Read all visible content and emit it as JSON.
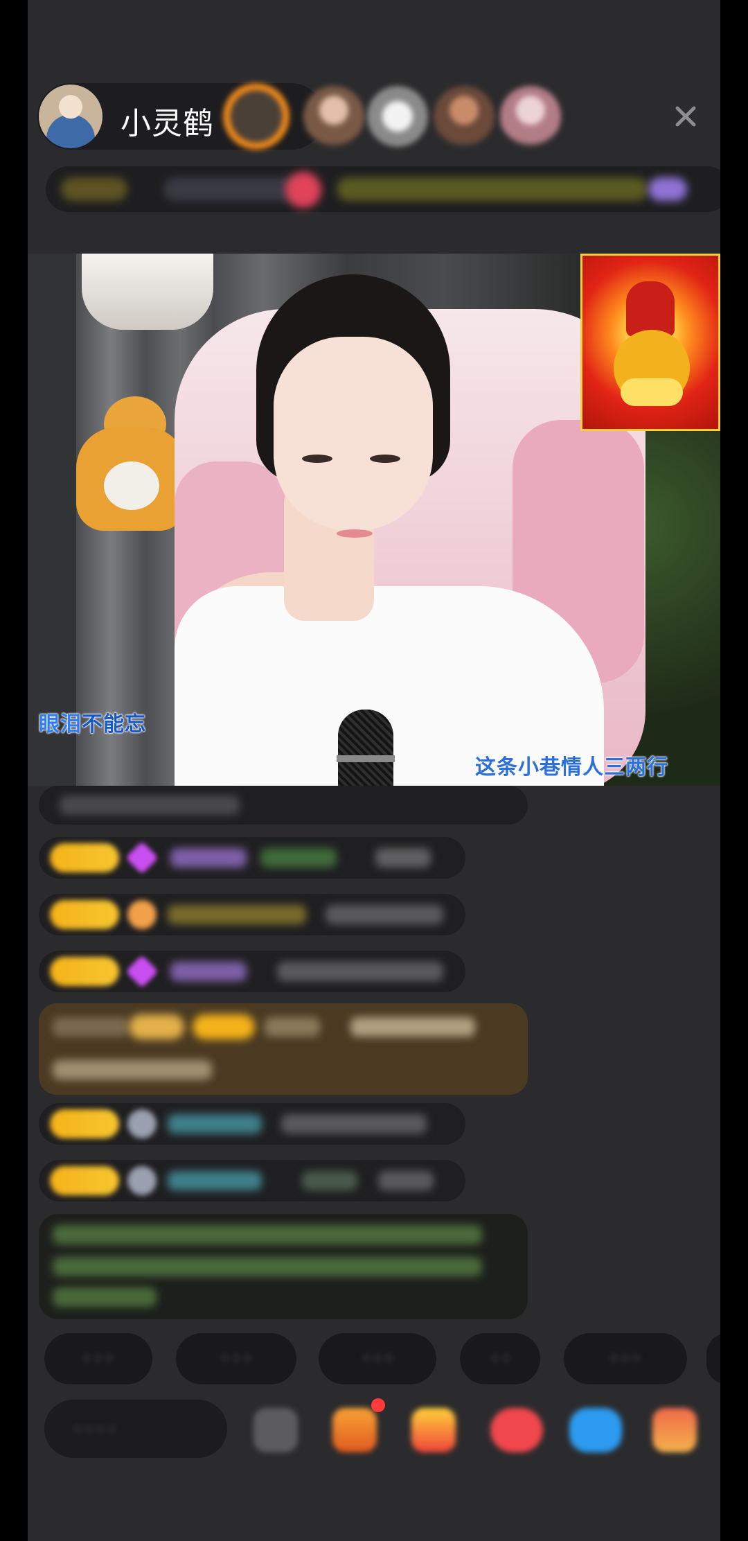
{
  "header": {
    "host_name": "小灵鹤",
    "host_badge_icon": "maple-leaf-icon",
    "viewer_count": 5,
    "close_icon": "close-icon"
  },
  "stats": {
    "items_blurred": true
  },
  "video": {
    "lyric_left_part1": "眼泪",
    "lyric_left_part2": "不能忘",
    "lyric_right": "这条小巷情人三两行",
    "sticker": "god-of-wealth-sticker"
  },
  "chat": {
    "messages_blurred": true,
    "message_count": 8
  },
  "quick_replies": {
    "count": 6,
    "blurred": true
  },
  "bottom_bar": {
    "input_blurred": true,
    "tool_icons": [
      "emoji-icon",
      "gift-box-icon",
      "fan-club-icon",
      "heart-icon",
      "game-icon",
      "more-icon"
    ]
  },
  "colors": {
    "background": "#2b2b2d",
    "badge_gold": "#f4b21a",
    "lyric_blue": "#2a6fdc"
  }
}
